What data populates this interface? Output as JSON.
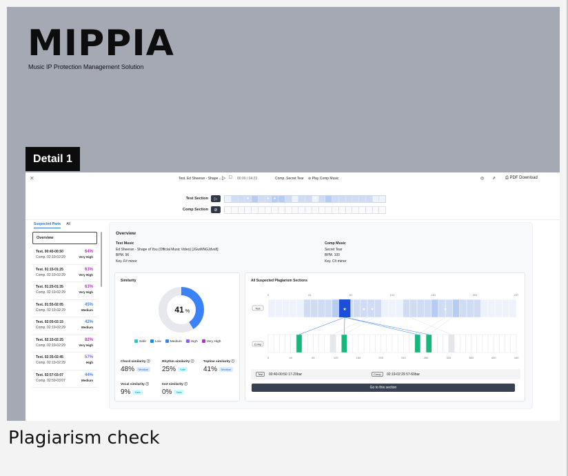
{
  "brand": {
    "logo": "MIPPIA",
    "tagline": "Music IP Protection Management Solution"
  },
  "badge": "Detail 1",
  "caption": "Plagiarism check",
  "colors": {
    "card_bg": "#a4a9b4",
    "accent_blue": "#2d6fe0",
    "safe": "#22c7e0",
    "low": "#1c8fe0",
    "medium": "#3b82f6",
    "high": "#8b5cf6",
    "very_high": "#c026d3",
    "green": "#16b77a"
  },
  "topbar": {
    "test_title": "Test. Ed Sheeran - Shape ...",
    "time": "00:00 / 04:23",
    "comp_title": "Comp. Secret Tear",
    "play_comp": "Play Comp Music",
    "pdf": "PDF Download"
  },
  "sections": {
    "test_label": "Test Section",
    "comp_label": "Comp Section"
  },
  "tabs": [
    "Suspected Parts",
    "All"
  ],
  "overview_label": "Overview",
  "parts": [
    {
      "test": "Test.   00:40-00:50",
      "comp": "Comp. 02:19-02:29",
      "pct": "64%",
      "level": "Very High",
      "color": "#c026d3"
    },
    {
      "test": "Test.   01:15-01:25",
      "comp": "Comp. 02:19-02:29",
      "pct": "63%",
      "level": "Very High",
      "color": "#c026d3"
    },
    {
      "test": "Test.   01:25-01:35",
      "comp": "Comp. 02:19-02:29",
      "pct": "63%",
      "level": "Very High",
      "color": "#c026d3"
    },
    {
      "test": "Test.   01:55-02:05",
      "comp": "Comp. 02:19-02:29",
      "pct": "45%",
      "level": "Medium",
      "color": "#3b82f6"
    },
    {
      "test": "Test.   02:05-02:15",
      "comp": "Comp. 02:19-02:29",
      "pct": "42%",
      "level": "Medium",
      "color": "#3b82f6"
    },
    {
      "test": "Test.   02:15-02:25",
      "comp": "Comp. 02:19-02:29",
      "pct": "82%",
      "level": "Very High",
      "color": "#c026d3"
    },
    {
      "test": "Test.   02:35-02:45",
      "comp": "Comp. 02:19-02:29",
      "pct": "57%",
      "level": "High",
      "color": "#8b5cf6"
    },
    {
      "test": "Test.   02:57-03:07",
      "comp": "Comp. 02:59-03:07",
      "pct": "44%",
      "level": "Medium",
      "color": "#3b82f6"
    }
  ],
  "overview": {
    "title": "Overview",
    "test_head": "Test Music",
    "test_name": "Ed Sheeran - Shape of You (Official Music Video) [JGwWNGJdvx8]",
    "test_bpm": "BPM. 96",
    "test_key": "Key. F# minor",
    "comp_head": "Comp Music",
    "comp_name": "Secret Tear",
    "comp_bpm": "BPM. 100",
    "comp_key": "Key. C# minor"
  },
  "similarity": {
    "title": "Similarity",
    "percent": 41,
    "percent_num": "41",
    "percent_sign": "%",
    "legend": [
      {
        "label": "Safe",
        "color": "#22c7e0"
      },
      {
        "label": "Low",
        "color": "#1c8fe0"
      },
      {
        "label": "Medium",
        "color": "#3b82f6"
      },
      {
        "label": "High",
        "color": "#8b5cf6"
      },
      {
        "label": "Very High",
        "color": "#c026d3"
      }
    ],
    "metrics": [
      {
        "name": "Chord similarity",
        "value": "48%",
        "tag": "Medium"
      },
      {
        "name": "Rhythm similarity",
        "value": "25%",
        "tag": "Safe"
      },
      {
        "name": "Topline similarity",
        "value": "41%",
        "tag": "Medium"
      },
      {
        "name": "Vocal similarity",
        "value": "9%",
        "tag": "Safe"
      },
      {
        "name": "Inst similarity",
        "value": "0%",
        "tag": "Safe"
      }
    ]
  },
  "plagiarism": {
    "title": "All Suspected Plagiarism Sections",
    "test_tag": "Test",
    "comp_tag": "Comp",
    "top_ticks": [
      "0",
      "41",
      "81",
      "121",
      "161",
      "201",
      "237"
    ],
    "bottom_ticks": [
      "0",
      "40",
      "80",
      "120",
      "160",
      "200",
      "240",
      "280",
      "320",
      "360",
      "400",
      "440"
    ],
    "info_test_tag": "Test",
    "info_test": "00:40-00:50   17-20bar",
    "info_comp_tag": "Comp",
    "info_comp": "02:19-02:29   57-60bar",
    "go_button": "Go to this section"
  }
}
